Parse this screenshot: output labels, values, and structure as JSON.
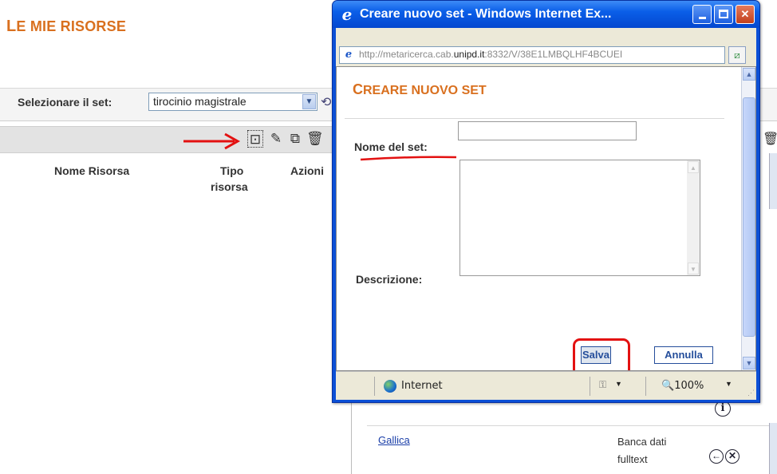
{
  "page": {
    "title_first": "L",
    "title_rest": "E MIE RISORSE",
    "set_label": "Selezionare il set:",
    "set_selected": "tirocinio magistrale",
    "columns": {
      "name": "Nome Risorsa",
      "type_line1": "Tipo",
      "type_line2": "risorsa",
      "actions": "Azioni"
    },
    "resource": {
      "name": "Gallica",
      "type_line1": "Banca dati",
      "type_line2": "fulltext"
    },
    "toolbar_icons": [
      "new-set-icon",
      "edit-set-icon",
      "copy-set-icon",
      "delete-set-icon"
    ]
  },
  "ie": {
    "window_title": "Creare nuovo set - Windows Internet Ex...",
    "url_prefix": "http://metaricerca.cab.",
    "url_domain": "unipd.it",
    "url_suffix": ":8332/V/38E1LMBQLHF4BCUEI",
    "status_zone": "Internet",
    "status_zoom": "100%"
  },
  "dialog": {
    "title_first": "C",
    "title_rest": "REARE NUOVO SET",
    "name_label": "Nome del set:",
    "name_value": "",
    "desc_label": "Descrizione:",
    "desc_value": "",
    "save_label": "Salva",
    "cancel_label": "Annulla"
  },
  "colors": {
    "title_orange": "#d9701f",
    "button_blue": "#254e9b",
    "annotation_red": "#e31111",
    "ie_blue": "#0b4fd6"
  }
}
